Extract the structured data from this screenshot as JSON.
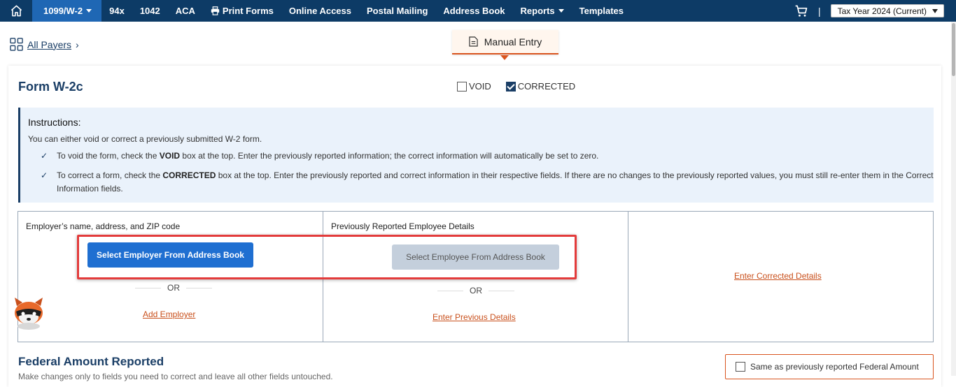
{
  "nav": {
    "items": [
      {
        "label": "1099/W-2",
        "active": true,
        "dropdown": true
      },
      {
        "label": "94x"
      },
      {
        "label": "1042"
      },
      {
        "label": "ACA"
      },
      {
        "label": "Print Forms",
        "icon": "printer-icon"
      },
      {
        "label": "Online Access"
      },
      {
        "label": "Postal Mailing"
      },
      {
        "label": "Address Book"
      },
      {
        "label": "Reports",
        "dropdown": true
      },
      {
        "label": "Templates"
      }
    ],
    "separator": "|",
    "tax_year": "Tax Year 2024 (Current)"
  },
  "breadcrumb": {
    "all_payers": "All Payers"
  },
  "tab": {
    "manual_entry": "Manual Entry"
  },
  "form": {
    "title": "Form W-2c",
    "void_label": "VOID",
    "void_checked": false,
    "corrected_label": "CORRECTED",
    "corrected_checked": true
  },
  "instructions": {
    "title": "Instructions:",
    "intro": "You can either void or correct a previously submitted W-2 form.",
    "item1_a": "To void the form, check the ",
    "item1_b": "VOID",
    "item1_c": " box at the top. Enter the previously reported information; the correct information will automatically be set to zero.",
    "item2_a": "To correct a form, check the ",
    "item2_b": "CORRECTED",
    "item2_c": " box at the top. Enter the previously reported and correct information in their respective fields. If there are no changes to the previously reported values, you must still re-enter them in the Correct Information fields."
  },
  "entry": {
    "employer_header": "Employer’s name, address, and ZIP code",
    "select_employer": "Select Employer From Address Book",
    "or1": "OR",
    "add_employer": "Add Employer",
    "employee_header": "Previously Reported Employee Details",
    "select_employee": "Select Employee From Address Book",
    "or2": "OR",
    "enter_previous": "Enter Previous Details",
    "enter_corrected": "Enter Corrected Details"
  },
  "federal": {
    "title": "Federal Amount Reported",
    "subtitle": "Make changes only to fields you need to correct and leave all other fields untouched.",
    "same_label": "Same as previously reported Federal Amount"
  },
  "colors": {
    "nav_bg": "#0d3b66",
    "nav_active": "#1f67b4",
    "accent_orange": "#d9541e",
    "primary_button": "#1f6fd1",
    "highlight_red": "#e33b3b"
  }
}
